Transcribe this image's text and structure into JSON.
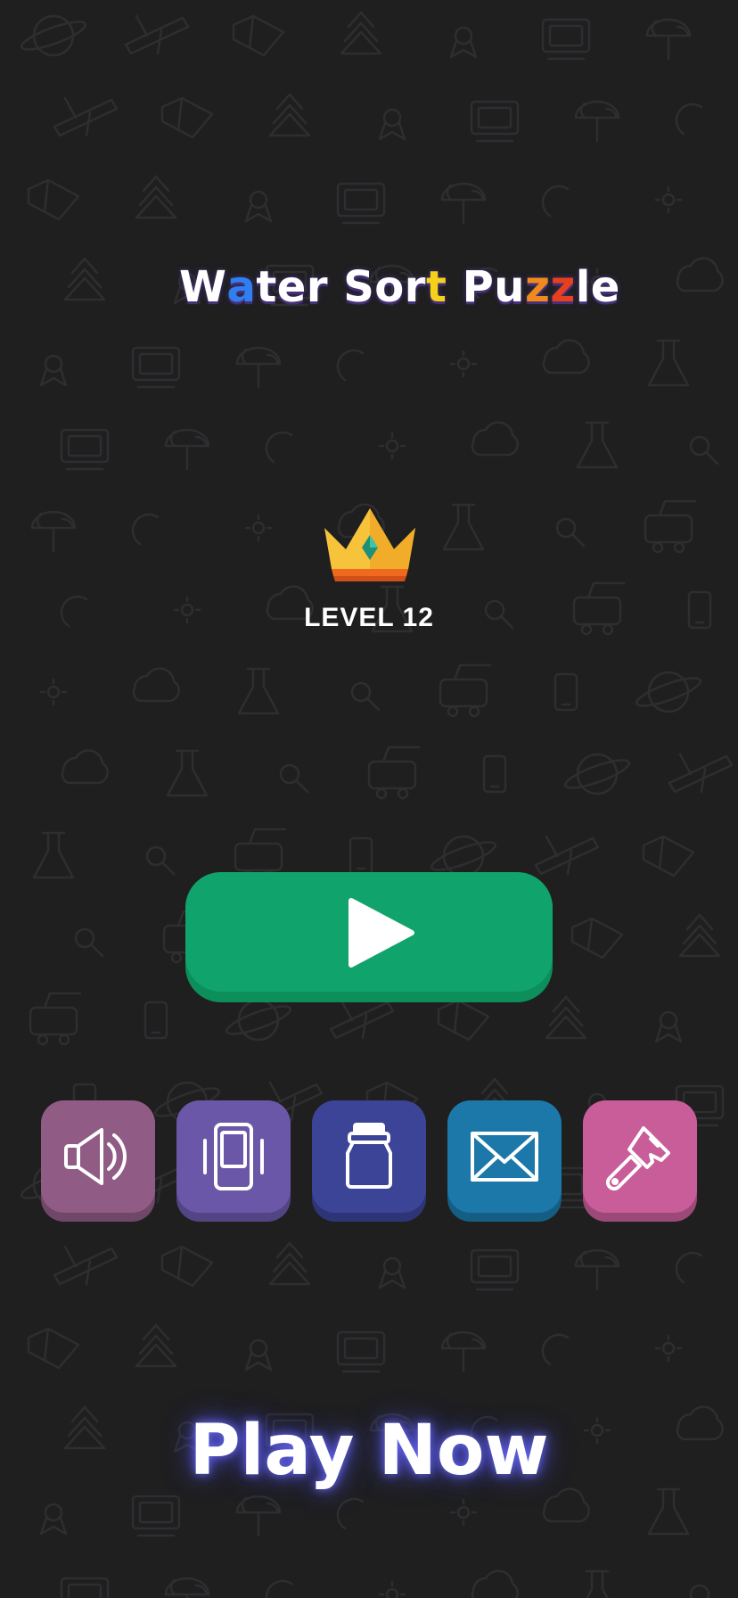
{
  "title": {
    "segments": [
      {
        "text": "W",
        "color": "#ffffff"
      },
      {
        "text": "a",
        "color": "#2f7ff0"
      },
      {
        "text": "ter ",
        "color": "#ffffff"
      },
      {
        "text": "Sor",
        "color": "#ffffff"
      },
      {
        "text": "t",
        "color": "#f6d11b"
      },
      {
        "text": " Pu",
        "color": "#ffffff"
      },
      {
        "text": "z",
        "color": "#f08a1c"
      },
      {
        "text": "z",
        "color": "#e8401c"
      },
      {
        "text": "le",
        "color": "#ffffff"
      }
    ]
  },
  "level": {
    "icon": "crown-icon",
    "label": "LEVEL 12"
  },
  "play_button": {
    "icon": "play-icon",
    "color": "#11a36c"
  },
  "menu": [
    {
      "name": "sound-button",
      "icon": "speaker-icon",
      "color": "#905b85"
    },
    {
      "name": "vibration-button",
      "icon": "vibration-icon",
      "color": "#6a57a8"
    },
    {
      "name": "shop-button",
      "icon": "jar-icon",
      "color": "#3b4497"
    },
    {
      "name": "mail-button",
      "icon": "envelope-icon",
      "color": "#1b78a8"
    },
    {
      "name": "theme-button",
      "icon": "paintbrush-icon",
      "color": "#c85d99"
    }
  ],
  "banner": {
    "label": "Play Now"
  }
}
